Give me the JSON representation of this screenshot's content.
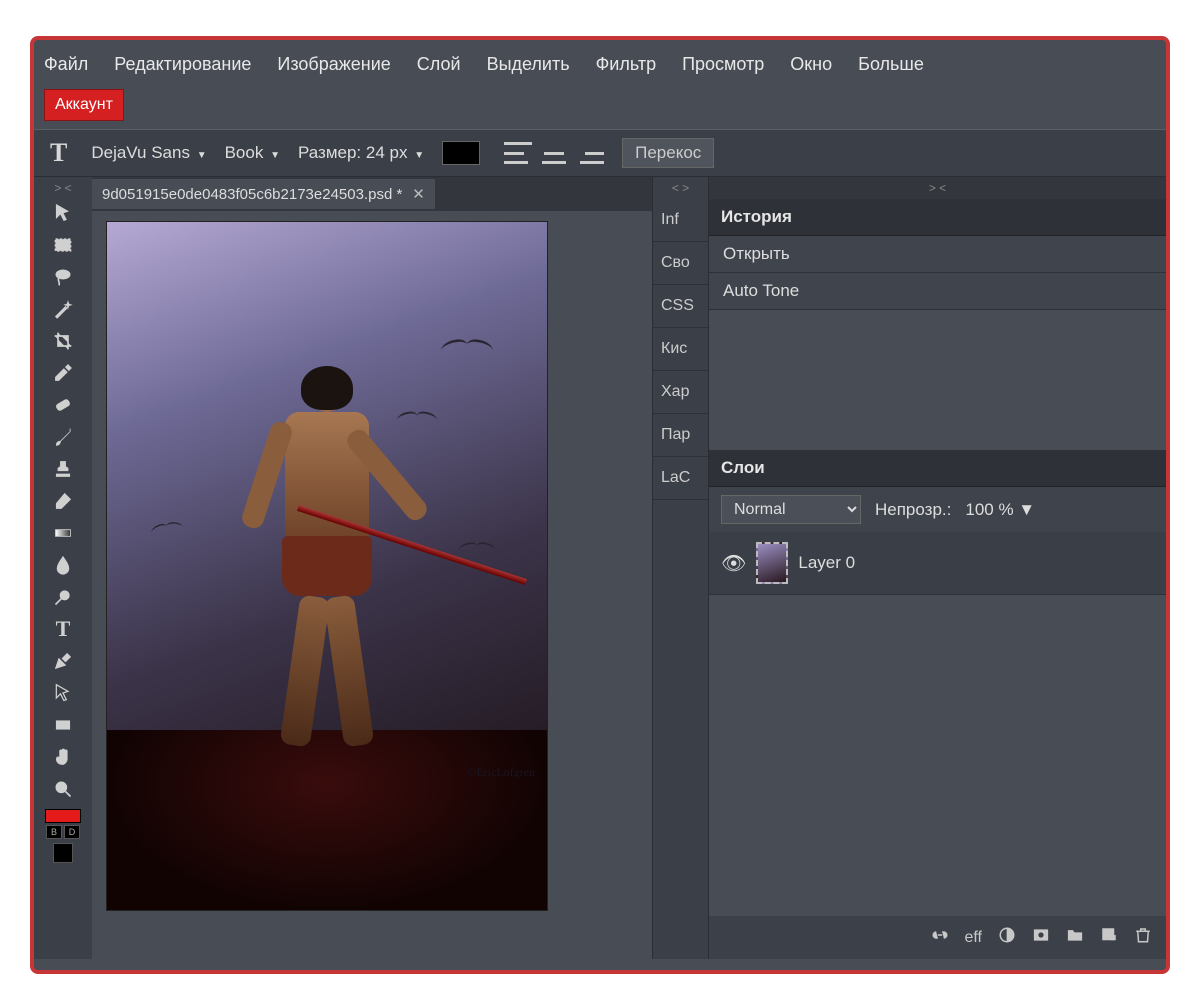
{
  "menu": {
    "file": "Файл",
    "edit": "Редактирование",
    "image": "Изображение",
    "layer": "Слой",
    "select": "Выделить",
    "filter": "Фильтр",
    "view": "Просмотр",
    "window": "Окно",
    "more": "Больше"
  },
  "account_btn": "Аккаунт",
  "optbar": {
    "font_family": "DejaVu Sans",
    "font_weight": "Book",
    "size_label": "Размер:",
    "size_value": "24 px",
    "skew_btn": "Перекос"
  },
  "document": {
    "tab_name": "9d051915e0de0483f05c6b2173e24503.psd *",
    "signature": "©EricLofgren"
  },
  "side_tabs": {
    "inf": "Inf",
    "svo": "Сво",
    "css": "CSS",
    "kis": "Кис",
    "har": "Хар",
    "par": "Пар",
    "lac": "LaC"
  },
  "panels": {
    "history_title": "История",
    "history_items": {
      "0": "Открыть",
      "1": "Auto Tone"
    },
    "layers_title": "Слои",
    "blend_mode": "Normal",
    "opacity_label": "Непрозр.:",
    "opacity_value": "100 %",
    "layer0_name": "Layer 0",
    "eff_label": "eff"
  },
  "color_chips": {
    "b": "B",
    "d": "D"
  },
  "resize_glyph": "> <",
  "resize_glyph2": "< >"
}
